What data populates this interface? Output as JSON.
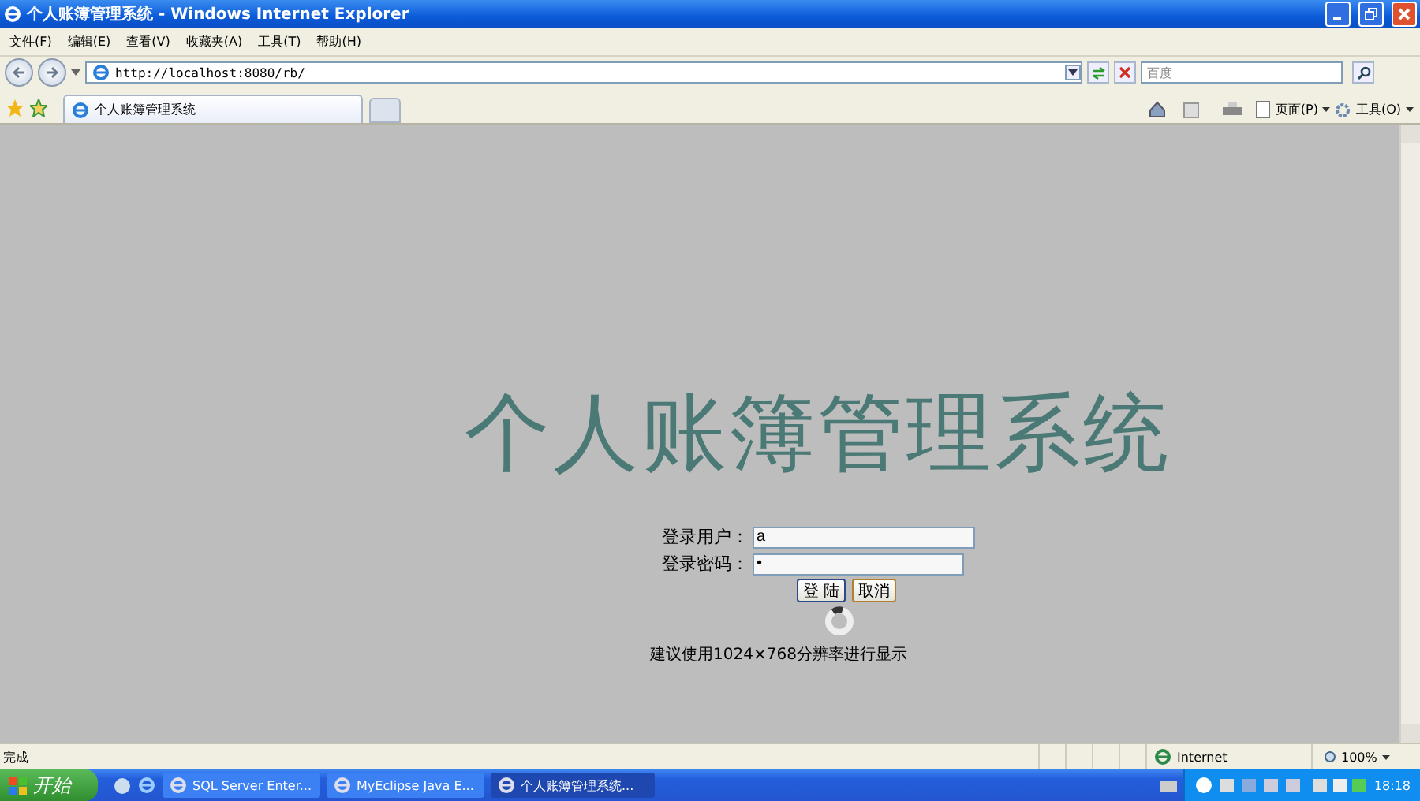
{
  "window": {
    "title": "个人账簿管理系统 - Windows Internet Explorer"
  },
  "menu": [
    "文件(F)",
    "编辑(E)",
    "查看(V)",
    "收藏夹(A)",
    "工具(T)",
    "帮助(H)"
  ],
  "address": {
    "value": "http://localhost:8080/rb/"
  },
  "search": {
    "placeholder": "百度"
  },
  "tabs": [
    {
      "label": "个人账簿管理系统",
      "selected": true
    }
  ],
  "command_bar": [
    {
      "label": "页面(P)"
    },
    {
      "label": "工具(O)"
    }
  ],
  "page": {
    "heading": "个人账簿管理系统",
    "fields": [
      {
        "label": "登录用户：",
        "value": "a"
      },
      {
        "label": "登录密码：",
        "value": "•"
      }
    ],
    "buttons": [
      "登 陆",
      "取消"
    ],
    "note": "建议使用1024×768分辨率进行显示"
  },
  "status_bar": {
    "text": "完成",
    "zone": "Internet",
    "zoom": "100%"
  },
  "taskbar": {
    "start": "开始",
    "tasks": [
      {
        "label": "SQL Server Enter...",
        "selected": false
      },
      {
        "label": "MyEclipse Java E...",
        "selected": false
      },
      {
        "label": "个人账簿管理系统...",
        "selected": true
      }
    ],
    "clock": "18:18"
  }
}
